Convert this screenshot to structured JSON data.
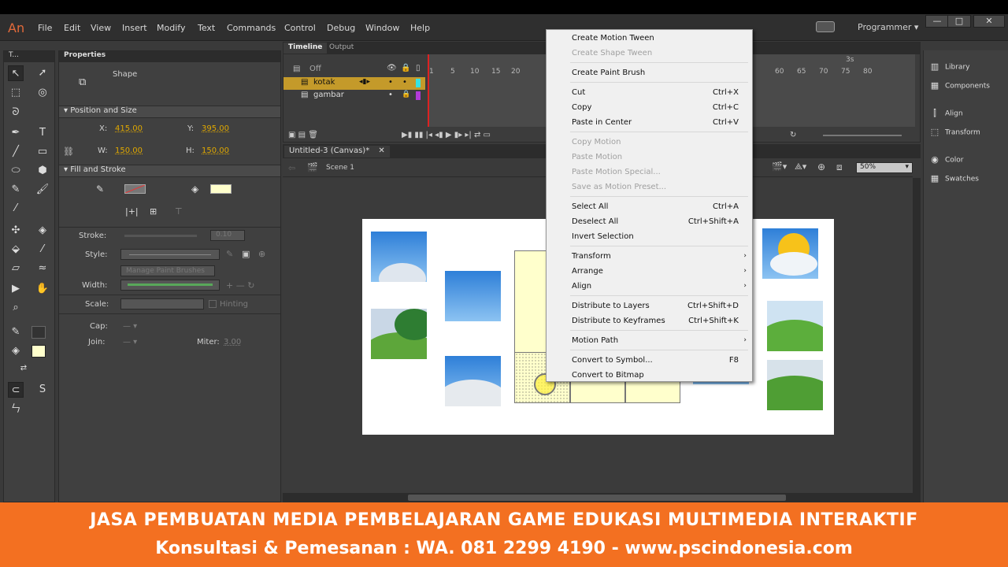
{
  "app": {
    "logo": "An",
    "workspace": "Programmer",
    "menu": [
      "File",
      "Edit",
      "View",
      "Insert",
      "Modify",
      "Text",
      "Commands",
      "Control",
      "Debug",
      "Window",
      "Help"
    ]
  },
  "tools_panel": {
    "title": "T..."
  },
  "properties": {
    "tab": "Properties",
    "object_type": "Shape",
    "position_size": {
      "header": "Position and Size",
      "x_label": "X:",
      "x": "415.00",
      "y_label": "Y:",
      "y": "395.00",
      "w_label": "W:",
      "w": "150.00",
      "h_label": "H:",
      "h": "150.00"
    },
    "fill_stroke": {
      "header": "Fill and Stroke",
      "fill_color": "#ffffcc",
      "stroke_label": "Stroke:",
      "stroke_value": "0.10",
      "style_label": "Style:",
      "manage_brushes": "Manage Paint Brushes",
      "width_label": "Width:",
      "scale_label": "Scale:",
      "hinting": "Hinting",
      "cap_label": "Cap:",
      "join_label": "Join:",
      "miter_label": "Miter:",
      "miter_value": "3.00"
    }
  },
  "timeline": {
    "tabs": [
      "Timeline",
      "Output"
    ],
    "off_label": "Off",
    "layers": [
      {
        "name": "kotak",
        "selected": true
      },
      {
        "name": "gambar",
        "selected": false
      }
    ],
    "frame_numbers": [
      "1",
      "5",
      "10",
      "15",
      "20",
      "60",
      "65",
      "70",
      "75",
      "80"
    ],
    "seconds_label": "3s"
  },
  "document": {
    "tab": "Untitled-3 (Canvas)*",
    "scene": "Scene 1",
    "zoom": "50%"
  },
  "dock": {
    "items": [
      {
        "label": "Library",
        "icon": "library-icon"
      },
      {
        "label": "Components",
        "icon": "components-icon"
      },
      {
        "label": "Align",
        "icon": "align-icon"
      },
      {
        "label": "Transform",
        "icon": "transform-icon"
      },
      {
        "label": "Color",
        "icon": "color-icon"
      },
      {
        "label": "Swatches",
        "icon": "swatches-icon"
      }
    ]
  },
  "context_menu": {
    "items": [
      {
        "label": "Create Motion Tween",
        "shortcut": "",
        "disabled": false,
        "submenu": false
      },
      {
        "label": "Create Shape Tween",
        "shortcut": "",
        "disabled": true,
        "submenu": false
      },
      {
        "sep": true
      },
      {
        "label": "Create Paint Brush",
        "shortcut": "",
        "disabled": false,
        "submenu": false
      },
      {
        "sep": true
      },
      {
        "label": "Cut",
        "shortcut": "Ctrl+X",
        "disabled": false,
        "submenu": false
      },
      {
        "label": "Copy",
        "shortcut": "Ctrl+C",
        "disabled": false,
        "submenu": false
      },
      {
        "label": "Paste in Center",
        "shortcut": "Ctrl+V",
        "disabled": false,
        "submenu": false
      },
      {
        "sep": true
      },
      {
        "label": "Copy Motion",
        "shortcut": "",
        "disabled": true,
        "submenu": false
      },
      {
        "label": "Paste Motion",
        "shortcut": "",
        "disabled": true,
        "submenu": false
      },
      {
        "label": "Paste Motion Special...",
        "shortcut": "",
        "disabled": true,
        "submenu": false
      },
      {
        "label": "Save as Motion Preset...",
        "shortcut": "",
        "disabled": true,
        "submenu": false
      },
      {
        "sep": true
      },
      {
        "label": "Select All",
        "shortcut": "Ctrl+A",
        "disabled": false,
        "submenu": false
      },
      {
        "label": "Deselect All",
        "shortcut": "Ctrl+Shift+A",
        "disabled": false,
        "submenu": false
      },
      {
        "label": "Invert Selection",
        "shortcut": "",
        "disabled": false,
        "submenu": false
      },
      {
        "sep": true
      },
      {
        "label": "Transform",
        "shortcut": "",
        "disabled": false,
        "submenu": true
      },
      {
        "label": "Arrange",
        "shortcut": "",
        "disabled": false,
        "submenu": true
      },
      {
        "label": "Align",
        "shortcut": "",
        "disabled": false,
        "submenu": true
      },
      {
        "sep": true
      },
      {
        "label": "Distribute to Layers",
        "shortcut": "Ctrl+Shift+D",
        "disabled": false,
        "submenu": false
      },
      {
        "label": "Distribute to Keyframes",
        "shortcut": "Ctrl+Shift+K",
        "disabled": false,
        "submenu": false
      },
      {
        "sep": true
      },
      {
        "label": "Motion Path",
        "shortcut": "",
        "disabled": false,
        "submenu": true
      },
      {
        "sep": true
      },
      {
        "label": "Convert to Symbol...",
        "shortcut": "F8",
        "disabled": false,
        "submenu": false
      },
      {
        "label": "Convert to Bitmap",
        "shortcut": "",
        "disabled": false,
        "submenu": false
      }
    ]
  },
  "banner": {
    "line1": "JASA PEMBUATAN MEDIA PEMBELAJARAN GAME EDUKASI MULTIMEDIA INTERAKTIF",
    "line2": "Konsultasi & Pemesanan : WA. 081 2299 4190 - www.pscindonesia.com"
  },
  "colors": {
    "accent_orange": "#f37021",
    "layer_selected": "#c49a2a",
    "playhead": "#dd2222"
  }
}
